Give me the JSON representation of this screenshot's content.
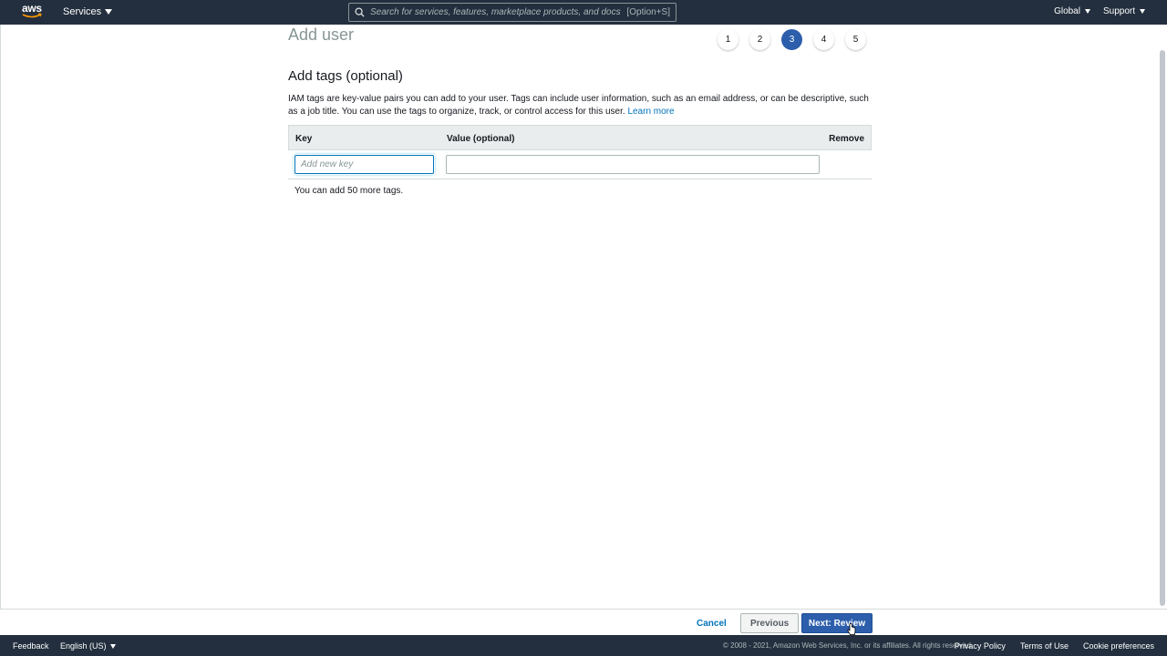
{
  "topnav": {
    "logo_text": "aws",
    "services_label": "Services",
    "search_placeholder": "Search for services, features, marketplace products, and docs",
    "search_shortcut": "[Option+S]",
    "region_label": "Global",
    "support_label": "Support"
  },
  "page": {
    "title": "Add user",
    "steps": [
      "1",
      "2",
      "3",
      "4",
      "5"
    ],
    "active_step": "3"
  },
  "section": {
    "title": "Add tags (optional)",
    "description": "IAM tags are key-value pairs you can add to your user. Tags can include user information, such as an email address, or can be descriptive, such as a job title. You can use the tags to organize, track, or control access for this user.",
    "learn_more": "Learn more"
  },
  "tags_table": {
    "headers": {
      "key": "Key",
      "value": "Value (optional)",
      "remove": "Remove"
    },
    "key_placeholder": "Add new key",
    "key_value": "",
    "value_value": "",
    "remaining": "You can add 50 more tags."
  },
  "actions": {
    "cancel": "Cancel",
    "previous": "Previous",
    "next": "Next: Review"
  },
  "footer": {
    "feedback": "Feedback",
    "language": "English (US)",
    "copyright": "© 2008 - 2021, Amazon Web Services, Inc. or its affiliates. All rights reserved.",
    "privacy": "Privacy Policy",
    "terms": "Terms of Use",
    "cookies": "Cookie preferences"
  },
  "colors": {
    "nav_bg": "#232f3e",
    "primary_button": "#2c5eab",
    "link": "#0073bb",
    "smile": "#ff9900"
  }
}
